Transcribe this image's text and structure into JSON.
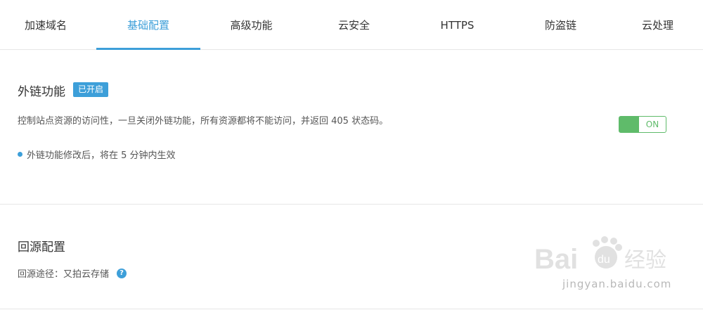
{
  "tabs": [
    {
      "label": "加速域名",
      "active": false
    },
    {
      "label": "基础配置",
      "active": true
    },
    {
      "label": "高级功能",
      "active": false
    },
    {
      "label": "云安全",
      "active": false
    },
    {
      "label": "HTTPS",
      "active": false
    },
    {
      "label": "防盗链",
      "active": false
    },
    {
      "label": "云处理",
      "active": false
    }
  ],
  "external_link": {
    "title": "外链功能",
    "badge": "已开启",
    "description": "控制站点资源的访问性，一旦关闭外链功能，所有资源都将不能访问，并返回 405 状态码。",
    "note": "外链功能修改后，将在 5 分钟内生效",
    "toggle_label": "ON",
    "toggle_on": true
  },
  "origin": {
    "title": "回源配置",
    "path_label": "回源途径：又拍云存储",
    "help_icon": "question-circle-icon"
  },
  "watermark": {
    "text": "jingyan.baidu.com",
    "logo": "Bai du 经验"
  },
  "colors": {
    "accent": "#3d9fd9",
    "toggle_on": "#5fbb6a",
    "divider": "#e6e6e6"
  }
}
